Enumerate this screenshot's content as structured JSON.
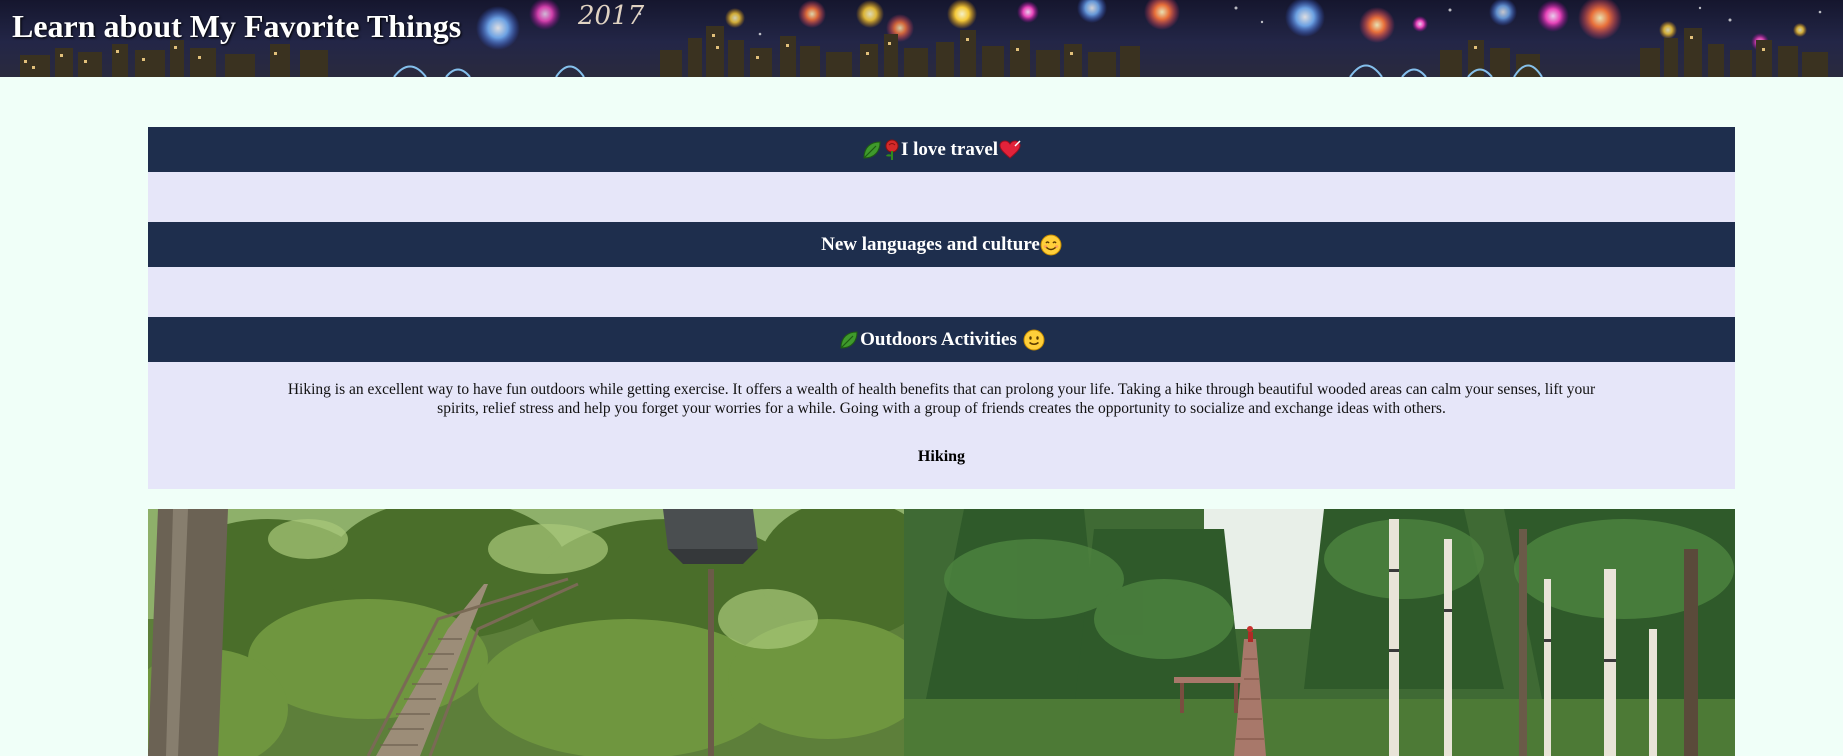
{
  "header": {
    "title": "Learn about My Favorite Things",
    "banner_image": "city-skyline-fireworks",
    "banner_year_text": "2017"
  },
  "sections": [
    {
      "icons_before": [
        "leaf-icon",
        "rose-icon"
      ],
      "title": "I love travel",
      "icons_after": [
        "heart-icon"
      ],
      "body": ""
    },
    {
      "icons_before": [],
      "title": "New languages and culture",
      "icons_after": [
        "smiling-face-icon"
      ],
      "body": ""
    },
    {
      "icons_before": [
        "leaf-icon"
      ],
      "title": "Outdoors Activities",
      "icons_after": [
        "slight-smile-icon"
      ],
      "body": "Hiking is an excellent way to have fun outdoors while getting exercise. It offers a wealth of health benefits that can prolong your life. Taking a hike through beautiful wooded areas can calm your senses, lift your spirits, relief stress and help you forget your worries for a while. Going with a group of friends creates the opportunity to socialize and exchange ideas with others.",
      "subheading": "Hiking"
    }
  ],
  "photos": [
    {
      "subject": "forest-stairway-with-lamp-post"
    },
    {
      "subject": "forest-boardwalk-with-birches"
    }
  ],
  "colors": {
    "page_background": "#f0fff8",
    "section_header": "#1e2e4d",
    "section_body": "#e6e6f9",
    "header_text": "#ffffff"
  }
}
